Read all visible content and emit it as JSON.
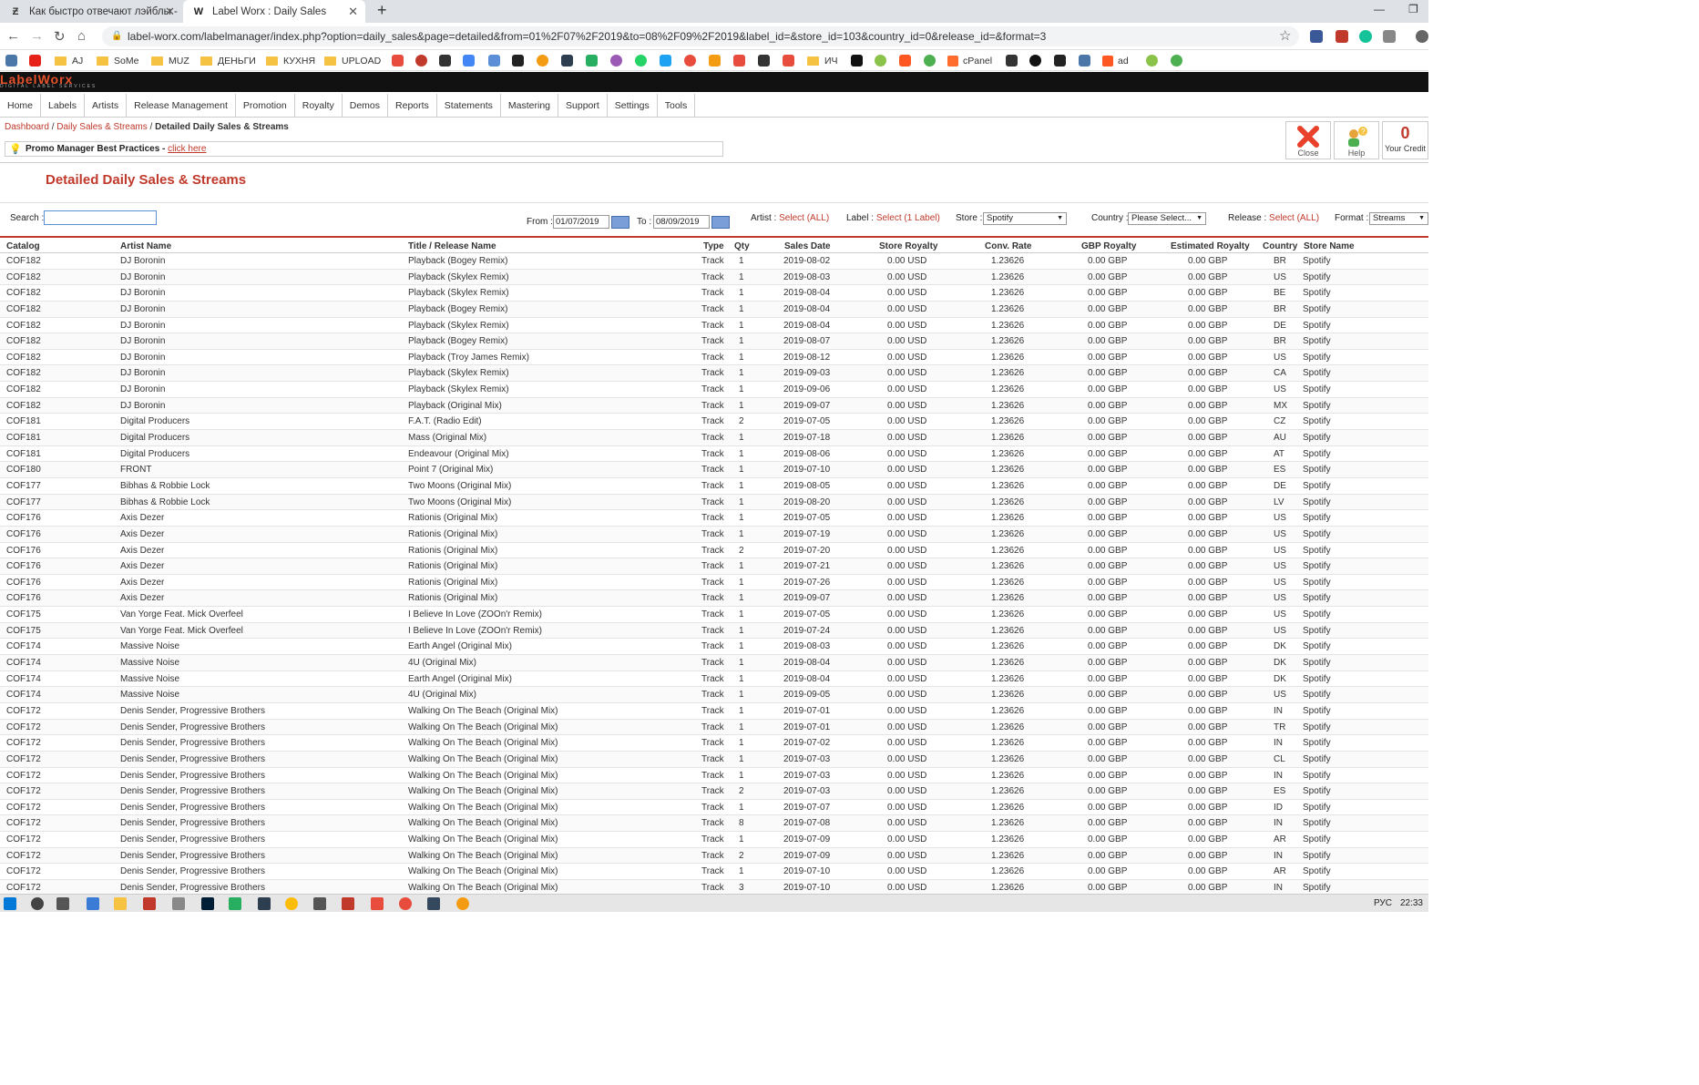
{
  "browser": {
    "tabs": [
      {
        "title": "Как быстро отвечают лэйблы -"
      },
      {
        "title": "Label Worx : Daily Sales"
      }
    ],
    "url": "label-worx.com/labelmanager/index.php?option=daily_sales&page=detailed&from=01%2F07%2F2019&to=08%2F09%2F2019&label_id=&store_id=103&country_id=0&release_id=&format=3",
    "bookmarks": [
      "AJ",
      "SoMe",
      "MUZ",
      "ДЕНЬГИ",
      "КУХНЯ",
      "UPLOAD",
      "ИЧ",
      "cPanel",
      "ad"
    ]
  },
  "app": {
    "logo": "LabelWorx",
    "logo_sub": "DIGITAL LABEL SERVICES",
    "menu": [
      "Home",
      "Labels",
      "Artists",
      "Release Management",
      "Promotion",
      "Royalty",
      "Demos",
      "Reports",
      "Statements",
      "Mastering",
      "Support",
      "Settings",
      "Tools"
    ],
    "breadcrumb": {
      "c1": "Dashboard",
      "sep": " / ",
      "c2": "Daily Sales & Streams",
      "current": "Detailed Daily Sales & Streams"
    },
    "promo": {
      "text": "Promo Manager Best Practices - ",
      "link": "click here"
    },
    "buttons": {
      "close": "Close",
      "help": "Help",
      "credit_value": "0",
      "credit_label": "Your Credit"
    },
    "page_title": "Detailed Daily Sales & Streams"
  },
  "filters": {
    "search_label": "Search :",
    "search_value": "",
    "from_label": "From :",
    "from_value": "01/07/2019",
    "to_label": "To :",
    "to_value": "08/09/2019",
    "artist_label": "Artist : ",
    "artist_value": "Select (ALL)",
    "label_label": "Label : ",
    "label_value": "Select (1 Label)",
    "store_label": "Store :",
    "store_value": "Spotify",
    "country_label": "Country :",
    "country_value": "Please Select...",
    "release_label": "Release : ",
    "release_value": "Select (ALL)",
    "format_label": "Format :",
    "format_value": "Streams"
  },
  "table": {
    "headers": [
      "Catalog",
      "Artist Name",
      "Title / Release Name",
      "Type",
      "Qty",
      "Sales Date",
      "Store Royalty",
      "Conv. Rate",
      "GBP Royalty",
      "Estimated Royalty",
      "Country",
      "Store Name"
    ],
    "rows": [
      [
        "COF182",
        "DJ Boronin",
        "Playback (Bogey Remix)",
        "Track",
        "1",
        "2019-08-02",
        "0.00 USD",
        "1.23626",
        "0.00 GBP",
        "0.00 GBP",
        "BR",
        "Spotify"
      ],
      [
        "COF182",
        "DJ Boronin",
        "Playback (Skylex Remix)",
        "Track",
        "1",
        "2019-08-03",
        "0.00 USD",
        "1.23626",
        "0.00 GBP",
        "0.00 GBP",
        "US",
        "Spotify"
      ],
      [
        "COF182",
        "DJ Boronin",
        "Playback (Skylex Remix)",
        "Track",
        "1",
        "2019-08-04",
        "0.00 USD",
        "1.23626",
        "0.00 GBP",
        "0.00 GBP",
        "BE",
        "Spotify"
      ],
      [
        "COF182",
        "DJ Boronin",
        "Playback (Bogey Remix)",
        "Track",
        "1",
        "2019-08-04",
        "0.00 USD",
        "1.23626",
        "0.00 GBP",
        "0.00 GBP",
        "BR",
        "Spotify"
      ],
      [
        "COF182",
        "DJ Boronin",
        "Playback (Skylex Remix)",
        "Track",
        "1",
        "2019-08-04",
        "0.00 USD",
        "1.23626",
        "0.00 GBP",
        "0.00 GBP",
        "DE",
        "Spotify"
      ],
      [
        "COF182",
        "DJ Boronin",
        "Playback (Bogey Remix)",
        "Track",
        "1",
        "2019-08-07",
        "0.00 USD",
        "1.23626",
        "0.00 GBP",
        "0.00 GBP",
        "BR",
        "Spotify"
      ],
      [
        "COF182",
        "DJ Boronin",
        "Playback (Troy James Remix)",
        "Track",
        "1",
        "2019-08-12",
        "0.00 USD",
        "1.23626",
        "0.00 GBP",
        "0.00 GBP",
        "US",
        "Spotify"
      ],
      [
        "COF182",
        "DJ Boronin",
        "Playback (Skylex Remix)",
        "Track",
        "1",
        "2019-09-03",
        "0.00 USD",
        "1.23626",
        "0.00 GBP",
        "0.00 GBP",
        "CA",
        "Spotify"
      ],
      [
        "COF182",
        "DJ Boronin",
        "Playback (Skylex Remix)",
        "Track",
        "1",
        "2019-09-06",
        "0.00 USD",
        "1.23626",
        "0.00 GBP",
        "0.00 GBP",
        "US",
        "Spotify"
      ],
      [
        "COF182",
        "DJ Boronin",
        "Playback (Original Mix)",
        "Track",
        "1",
        "2019-09-07",
        "0.00 USD",
        "1.23626",
        "0.00 GBP",
        "0.00 GBP",
        "MX",
        "Spotify"
      ],
      [
        "COF181",
        "Digital Producers",
        "F.A.T. (Radio Edit)",
        "Track",
        "2",
        "2019-07-05",
        "0.00 USD",
        "1.23626",
        "0.00 GBP",
        "0.00 GBP",
        "CZ",
        "Spotify"
      ],
      [
        "COF181",
        "Digital Producers",
        "Mass (Original Mix)",
        "Track",
        "1",
        "2019-07-18",
        "0.00 USD",
        "1.23626",
        "0.00 GBP",
        "0.00 GBP",
        "AU",
        "Spotify"
      ],
      [
        "COF181",
        "Digital Producers",
        "Endeavour (Original Mix)",
        "Track",
        "1",
        "2019-08-06",
        "0.00 USD",
        "1.23626",
        "0.00 GBP",
        "0.00 GBP",
        "AT",
        "Spotify"
      ],
      [
        "COF180",
        "FRONT",
        "Point 7 (Original Mix)",
        "Track",
        "1",
        "2019-07-10",
        "0.00 USD",
        "1.23626",
        "0.00 GBP",
        "0.00 GBP",
        "ES",
        "Spotify"
      ],
      [
        "COF177",
        "Bibhas & Robbie Lock",
        "Two Moons (Original Mix)",
        "Track",
        "1",
        "2019-08-05",
        "0.00 USD",
        "1.23626",
        "0.00 GBP",
        "0.00 GBP",
        "DE",
        "Spotify"
      ],
      [
        "COF177",
        "Bibhas & Robbie Lock",
        "Two Moons (Original Mix)",
        "Track",
        "1",
        "2019-08-20",
        "0.00 USD",
        "1.23626",
        "0.00 GBP",
        "0.00 GBP",
        "LV",
        "Spotify"
      ],
      [
        "COF176",
        "Axis Dezer",
        "Rationis (Original Mix)",
        "Track",
        "1",
        "2019-07-05",
        "0.00 USD",
        "1.23626",
        "0.00 GBP",
        "0.00 GBP",
        "US",
        "Spotify"
      ],
      [
        "COF176",
        "Axis Dezer",
        "Rationis (Original Mix)",
        "Track",
        "1",
        "2019-07-19",
        "0.00 USD",
        "1.23626",
        "0.00 GBP",
        "0.00 GBP",
        "US",
        "Spotify"
      ],
      [
        "COF176",
        "Axis Dezer",
        "Rationis (Original Mix)",
        "Track",
        "2",
        "2019-07-20",
        "0.00 USD",
        "1.23626",
        "0.00 GBP",
        "0.00 GBP",
        "US",
        "Spotify"
      ],
      [
        "COF176",
        "Axis Dezer",
        "Rationis (Original Mix)",
        "Track",
        "1",
        "2019-07-21",
        "0.00 USD",
        "1.23626",
        "0.00 GBP",
        "0.00 GBP",
        "US",
        "Spotify"
      ],
      [
        "COF176",
        "Axis Dezer",
        "Rationis (Original Mix)",
        "Track",
        "1",
        "2019-07-26",
        "0.00 USD",
        "1.23626",
        "0.00 GBP",
        "0.00 GBP",
        "US",
        "Spotify"
      ],
      [
        "COF176",
        "Axis Dezer",
        "Rationis (Original Mix)",
        "Track",
        "1",
        "2019-09-07",
        "0.00 USD",
        "1.23626",
        "0.00 GBP",
        "0.00 GBP",
        "US",
        "Spotify"
      ],
      [
        "COF175",
        "Van Yorge Feat. Mick Overfeel",
        "I Believe In Love (ZOOn'r Remix)",
        "Track",
        "1",
        "2019-07-05",
        "0.00 USD",
        "1.23626",
        "0.00 GBP",
        "0.00 GBP",
        "US",
        "Spotify"
      ],
      [
        "COF175",
        "Van Yorge Feat. Mick Overfeel",
        "I Believe In Love (ZOOn'r Remix)",
        "Track",
        "1",
        "2019-07-24",
        "0.00 USD",
        "1.23626",
        "0.00 GBP",
        "0.00 GBP",
        "US",
        "Spotify"
      ],
      [
        "COF174",
        "Massive Noise",
        "Earth Angel (Original Mix)",
        "Track",
        "1",
        "2019-08-03",
        "0.00 USD",
        "1.23626",
        "0.00 GBP",
        "0.00 GBP",
        "DK",
        "Spotify"
      ],
      [
        "COF174",
        "Massive Noise",
        "4U (Original Mix)",
        "Track",
        "1",
        "2019-08-04",
        "0.00 USD",
        "1.23626",
        "0.00 GBP",
        "0.00 GBP",
        "DK",
        "Spotify"
      ],
      [
        "COF174",
        "Massive Noise",
        "Earth Angel (Original Mix)",
        "Track",
        "1",
        "2019-08-04",
        "0.00 USD",
        "1.23626",
        "0.00 GBP",
        "0.00 GBP",
        "DK",
        "Spotify"
      ],
      [
        "COF174",
        "Massive Noise",
        "4U (Original Mix)",
        "Track",
        "1",
        "2019-09-05",
        "0.00 USD",
        "1.23626",
        "0.00 GBP",
        "0.00 GBP",
        "US",
        "Spotify"
      ],
      [
        "COF172",
        "Denis Sender, Progressive Brothers",
        "Walking On The Beach (Original Mix)",
        "Track",
        "1",
        "2019-07-01",
        "0.00 USD",
        "1.23626",
        "0.00 GBP",
        "0.00 GBP",
        "IN",
        "Spotify"
      ],
      [
        "COF172",
        "Denis Sender, Progressive Brothers",
        "Walking On The Beach (Original Mix)",
        "Track",
        "1",
        "2019-07-01",
        "0.00 USD",
        "1.23626",
        "0.00 GBP",
        "0.00 GBP",
        "TR",
        "Spotify"
      ],
      [
        "COF172",
        "Denis Sender, Progressive Brothers",
        "Walking On The Beach (Original Mix)",
        "Track",
        "1",
        "2019-07-02",
        "0.00 USD",
        "1.23626",
        "0.00 GBP",
        "0.00 GBP",
        "IN",
        "Spotify"
      ],
      [
        "COF172",
        "Denis Sender, Progressive Brothers",
        "Walking On The Beach (Original Mix)",
        "Track",
        "1",
        "2019-07-03",
        "0.00 USD",
        "1.23626",
        "0.00 GBP",
        "0.00 GBP",
        "CL",
        "Spotify"
      ],
      [
        "COF172",
        "Denis Sender, Progressive Brothers",
        "Walking On The Beach (Original Mix)",
        "Track",
        "1",
        "2019-07-03",
        "0.00 USD",
        "1.23626",
        "0.00 GBP",
        "0.00 GBP",
        "IN",
        "Spotify"
      ],
      [
        "COF172",
        "Denis Sender, Progressive Brothers",
        "Walking On The Beach (Original Mix)",
        "Track",
        "2",
        "2019-07-03",
        "0.00 USD",
        "1.23626",
        "0.00 GBP",
        "0.00 GBP",
        "ES",
        "Spotify"
      ],
      [
        "COF172",
        "Denis Sender, Progressive Brothers",
        "Walking On The Beach (Original Mix)",
        "Track",
        "1",
        "2019-07-07",
        "0.00 USD",
        "1.23626",
        "0.00 GBP",
        "0.00 GBP",
        "ID",
        "Spotify"
      ],
      [
        "COF172",
        "Denis Sender, Progressive Brothers",
        "Walking On The Beach (Original Mix)",
        "Track",
        "8",
        "2019-07-08",
        "0.00 USD",
        "1.23626",
        "0.00 GBP",
        "0.00 GBP",
        "IN",
        "Spotify"
      ],
      [
        "COF172",
        "Denis Sender, Progressive Brothers",
        "Walking On The Beach (Original Mix)",
        "Track",
        "1",
        "2019-07-09",
        "0.00 USD",
        "1.23626",
        "0.00 GBP",
        "0.00 GBP",
        "AR",
        "Spotify"
      ],
      [
        "COF172",
        "Denis Sender, Progressive Brothers",
        "Walking On The Beach (Original Mix)",
        "Track",
        "2",
        "2019-07-09",
        "0.00 USD",
        "1.23626",
        "0.00 GBP",
        "0.00 GBP",
        "IN",
        "Spotify"
      ],
      [
        "COF172",
        "Denis Sender, Progressive Brothers",
        "Walking On The Beach (Original Mix)",
        "Track",
        "1",
        "2019-07-10",
        "0.00 USD",
        "1.23626",
        "0.00 GBP",
        "0.00 GBP",
        "AR",
        "Spotify"
      ],
      [
        "COF172",
        "Denis Sender, Progressive Brothers",
        "Walking On The Beach (Original Mix)",
        "Track",
        "3",
        "2019-07-10",
        "0.00 USD",
        "1.23626",
        "0.00 GBP",
        "0.00 GBP",
        "IN",
        "Spotify"
      ]
    ]
  },
  "taskbar": {
    "lang": "РУС",
    "time": "22:33"
  }
}
